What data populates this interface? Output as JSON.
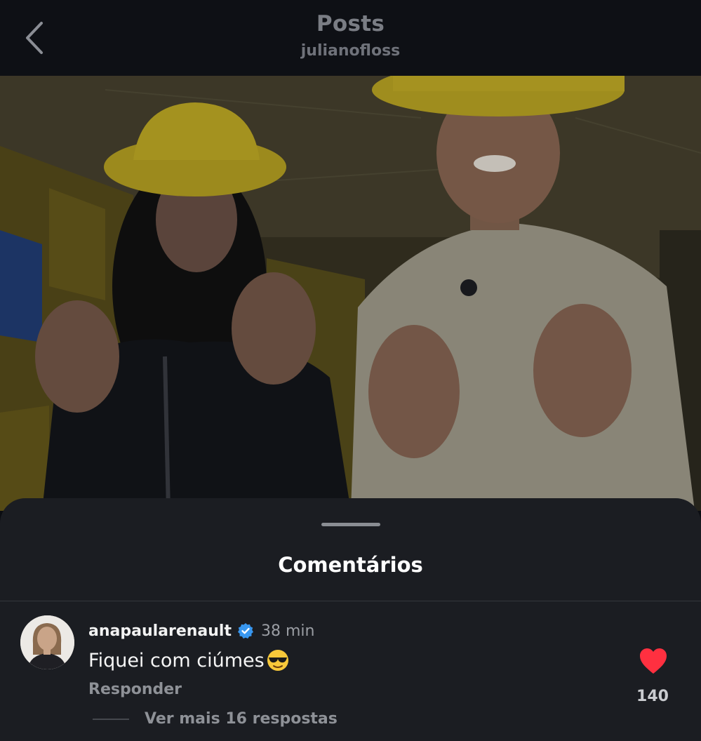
{
  "header": {
    "title": "Posts",
    "username": "julianofloss",
    "back_icon": "chevron-left-icon"
  },
  "comments_sheet": {
    "title": "Comentários",
    "comment": {
      "username": "anapaularenault",
      "verified": true,
      "time": "38 min",
      "text": "Fiquei com ciúmes",
      "emoji": "smiling-face-with-sunglasses",
      "reply_label": "Responder",
      "like_count": "140",
      "liked": true,
      "view_replies_label": "Ver mais 16 respostas"
    }
  },
  "colors": {
    "background": "#0b0d12",
    "sheet": "#1b1d22",
    "verified_blue": "#3897f0",
    "like_red": "#ff3040",
    "hat_yellow": "#e3cc2a"
  }
}
